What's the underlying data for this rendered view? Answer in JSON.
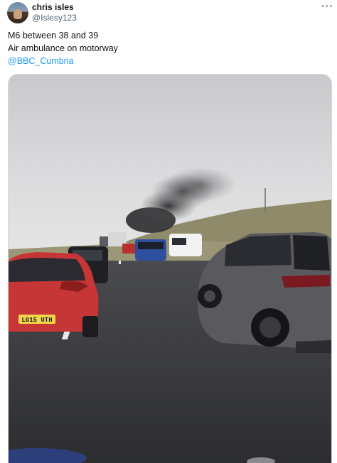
{
  "author": {
    "display_name": "chris isles",
    "handle": "@Islesy123",
    "avatar_icon": "profile-avatar"
  },
  "more_icon": "more-options-icon",
  "tweet": {
    "line1": "M6 between 38 and 39",
    "line2": "Air ambulance on motorway",
    "mention": "@BBC_Cumbria"
  },
  "media": {
    "number_plate": "LG15 UTH"
  },
  "colors": {
    "text_primary": "#0f1419",
    "text_secondary": "#536471",
    "link": "#1d9bf0",
    "border": "#cfd9de"
  }
}
